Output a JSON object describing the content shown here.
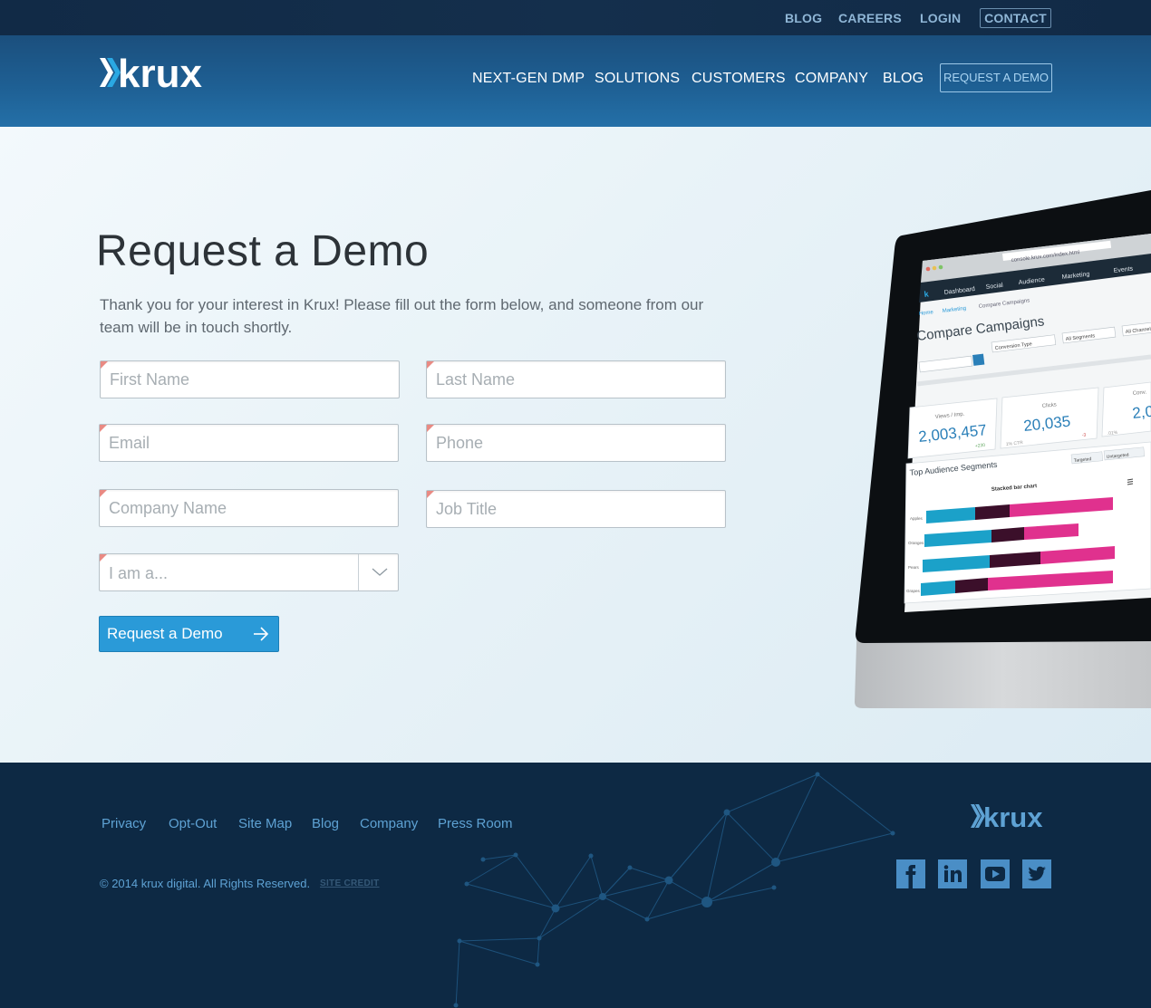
{
  "topbar": {
    "blog": "BLOG",
    "careers": "CAREERS",
    "login": "LOGIN",
    "contact": "CONTACT"
  },
  "header": {
    "logo_text": "krux",
    "nav": [
      "NEXT-GEN DMP",
      "SOLUTIONS",
      "CUSTOMERS",
      "COMPANY",
      "BLOG"
    ],
    "request_demo": "REQUEST A DEMO"
  },
  "main": {
    "title": "Request a Demo",
    "intro": "Thank you for your interest in Krux! Please fill out the form below, and someone from our team will be in touch shortly.",
    "form": {
      "first_name_placeholder": "First Name",
      "last_name_placeholder": "Last Name",
      "email_placeholder": "Email",
      "phone_placeholder": "Phone",
      "company_placeholder": "Company Name",
      "job_title_placeholder": "Job Title",
      "role_select": "I am a...",
      "submit_label": "Request a Demo"
    }
  },
  "monitor_screen": {
    "url": "console.krux.com/index.html",
    "tabs": [
      "Dashboard",
      "Social",
      "Audience",
      "Marketing",
      "Events"
    ],
    "breadcrumb": [
      "Home",
      "Marketing",
      "Compare Campaigns"
    ],
    "heading": "Compare Campaigns",
    "filters": [
      "Conversion Type",
      "All Segments",
      "All Channels"
    ],
    "stats": [
      {
        "label": "Views / Imp.",
        "value": "2,003,457",
        "delta": "+230"
      },
      {
        "label": "Clicks",
        "value": "20,035",
        "delta": "-3"
      },
      {
        "label": "Conv.",
        "value": "2,0"
      }
    ],
    "stat_notes": [
      "1% CTR",
      ".01%"
    ],
    "segments_title": "Top Audience Segments",
    "segment_toggles": [
      "Targeted",
      "Untargeted"
    ],
    "chart_title": "Stacked bar chart",
    "chart_rows": [
      "Apples",
      "Oranges",
      "Pears",
      "Grapes"
    ]
  },
  "footer": {
    "links": [
      "Privacy",
      "Opt-Out",
      "Site Map",
      "Blog",
      "Company",
      "Press Room"
    ],
    "copyright": "© 2014 krux digital. All Rights Reserved.",
    "credit": "SITE CREDIT",
    "logo_text": "krux",
    "social": [
      "facebook-icon",
      "linkedin-icon",
      "youtube-icon",
      "twitter-icon"
    ]
  },
  "colors": {
    "accent": "#2a9ad8",
    "header_blue": "#1e5f93",
    "footer_navy": "#0d2944",
    "required_marker": "#e98a83",
    "footer_link": "#5ea2d4"
  }
}
